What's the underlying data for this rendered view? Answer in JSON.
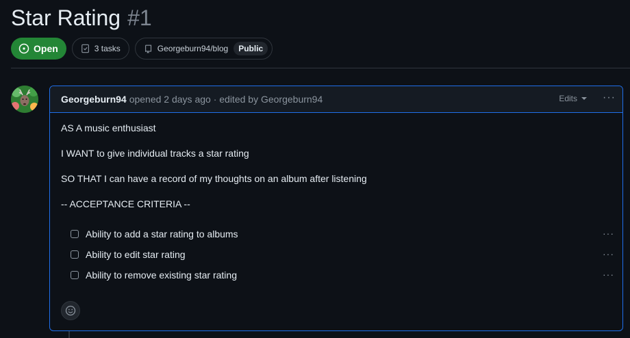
{
  "issue": {
    "title": "Star Rating",
    "number": "#1",
    "state": "Open",
    "tasks_label": "3 tasks",
    "repo": "Georgeburn94/blog",
    "visibility": "Public"
  },
  "comment": {
    "author": "Georgeburn94",
    "meta": "opened 2 days ago · edited by Georgeburn94",
    "edits_label": "Edits",
    "menu": "···",
    "paragraphs": [
      "AS A music enthusiast",
      "I WANT to give individual tracks a star rating",
      "SO THAT I can have a record of my thoughts on an album after listening",
      "-- ACCEPTANCE CRITERIA --"
    ],
    "tasks": [
      {
        "label": "Ability to add a star rating to albums",
        "checked": false
      },
      {
        "label": "Ability to edit star rating",
        "checked": false
      },
      {
        "label": "Ability to remove existing star rating",
        "checked": false
      }
    ],
    "task_menu": "···"
  },
  "colors": {
    "accent": "#1f6feb",
    "open_green": "#238636",
    "background": "#0d1117"
  }
}
